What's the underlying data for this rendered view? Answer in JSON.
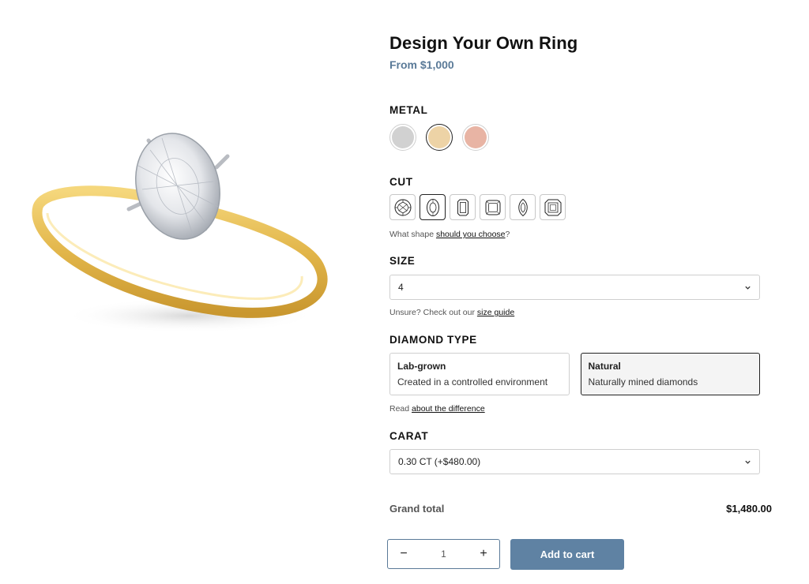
{
  "product": {
    "title": "Design Your Own Ring",
    "price": "From $1,000"
  },
  "metal": {
    "label": "METAL",
    "options": [
      {
        "name": "white-gold",
        "color": "#d1d1d1",
        "selected": false
      },
      {
        "name": "yellow-gold",
        "color": "#edd3a6",
        "selected": true
      },
      {
        "name": "rose-gold",
        "color": "#e8b4a4",
        "selected": false
      }
    ]
  },
  "cut": {
    "label": "CUT",
    "options": [
      "round",
      "oval",
      "emerald",
      "cushion",
      "marquise",
      "asscher"
    ],
    "selected": "oval",
    "helper_prefix": "What shape ",
    "helper_link": "should you choose",
    "helper_suffix": "?"
  },
  "size": {
    "label": "SIZE",
    "value": "4",
    "helper_prefix": "Unsure? Check out our ",
    "helper_link": "size guide"
  },
  "diamond_type": {
    "label": "DIAMOND TYPE",
    "options": [
      {
        "title": "Lab-grown",
        "desc": "Created in a controlled environment",
        "selected": false
      },
      {
        "title": "Natural",
        "desc": "Naturally mined diamonds",
        "selected": true
      }
    ],
    "helper_prefix": "Read ",
    "helper_link": "about the difference"
  },
  "carat": {
    "label": "CARAT",
    "value": "0.30 CT (+$480.00)"
  },
  "total": {
    "label": "Grand total",
    "value": "$1,480.00"
  },
  "quantity": {
    "minus": "−",
    "value": "1",
    "plus": "+"
  },
  "cart": {
    "label": "Add to cart"
  },
  "colors": {
    "accent": "#5f82a3",
    "price": "#5a7a98",
    "band": "#e9c45e"
  }
}
